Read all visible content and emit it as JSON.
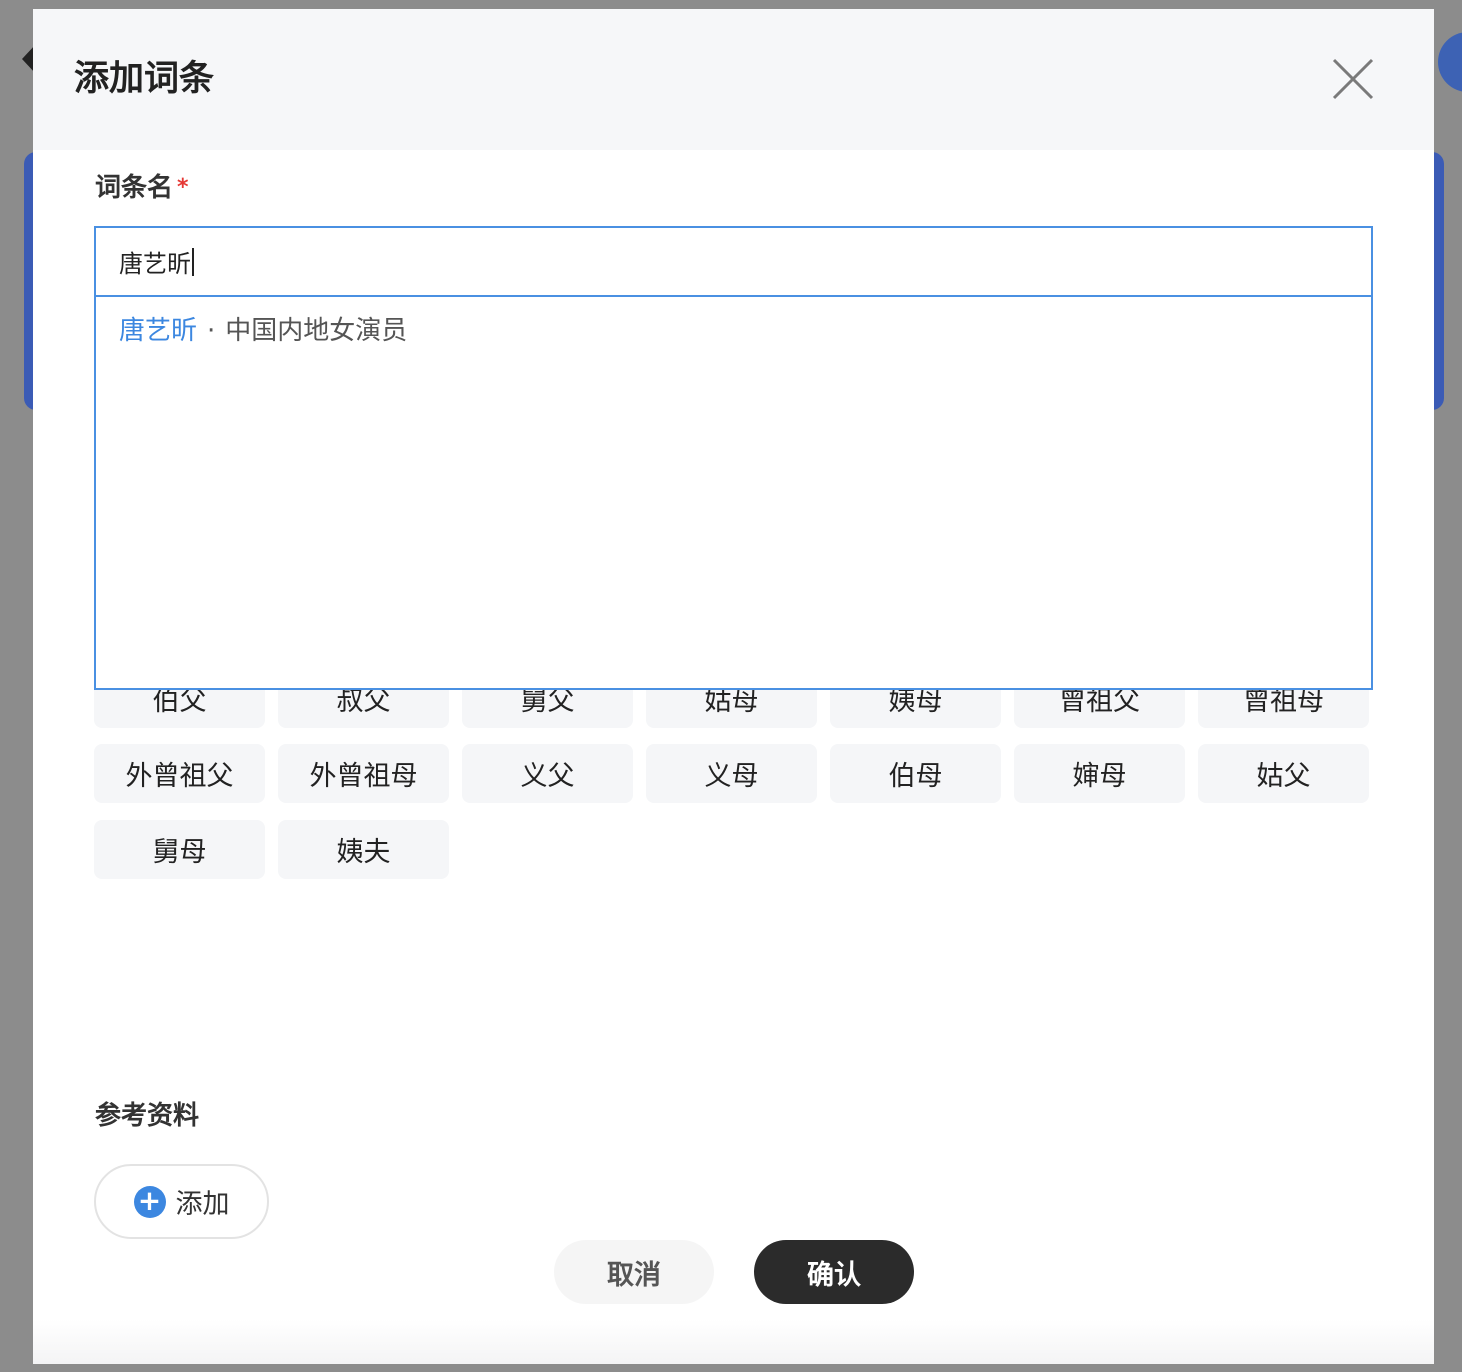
{
  "dialog": {
    "title": "添加词条",
    "close_icon": "close-icon"
  },
  "name_field": {
    "label": "词条名",
    "required_mark": "*",
    "value": "唐艺昕"
  },
  "suggestion": {
    "name": "唐艺昕",
    "separator": "·",
    "description": "中国内地女演员"
  },
  "relation_tags": {
    "row1": [
      "伯父",
      "叔父",
      "舅父",
      "姑母",
      "姨母",
      "曾祖父",
      "曾祖母"
    ],
    "row2": [
      "外曾祖父",
      "外曾祖母",
      "义父",
      "义母",
      "伯母",
      "婶母",
      "姑父"
    ],
    "row3": [
      "舅母",
      "姨夫"
    ]
  },
  "references": {
    "label": "参考资料",
    "add_label": "添加",
    "add_icon": "plus-circle-icon"
  },
  "actions": {
    "cancel": "取消",
    "confirm": "确认"
  },
  "colors": {
    "accent_blue": "#3c87e0",
    "confirm_bg": "#2b2b2b",
    "required_red": "#e53935"
  }
}
